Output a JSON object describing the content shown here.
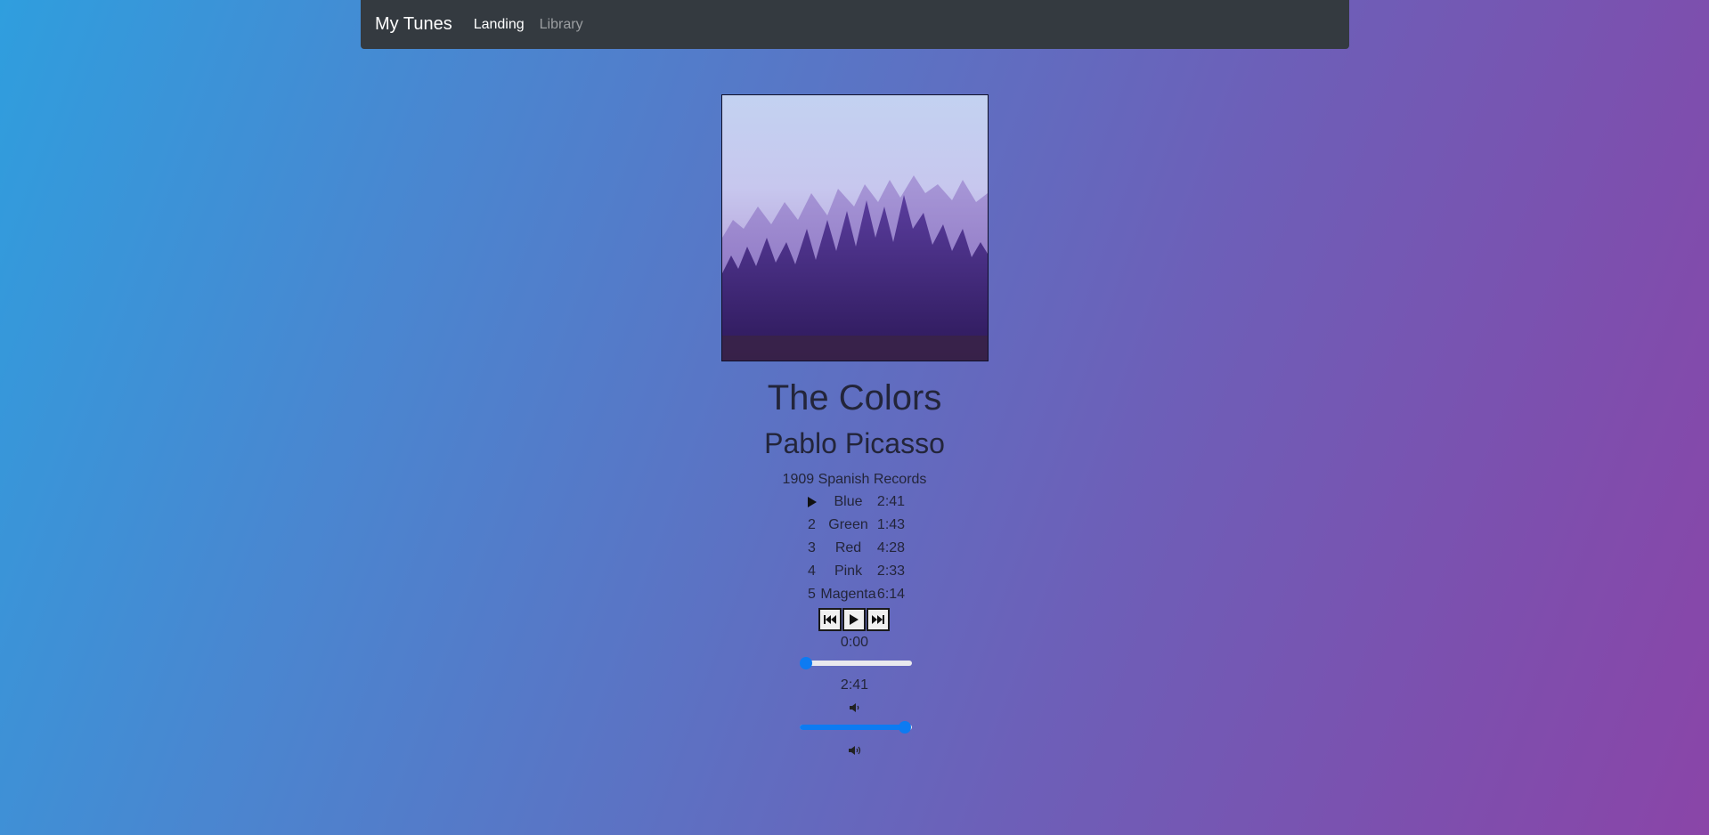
{
  "navbar": {
    "brand": "My Tunes",
    "links": [
      {
        "label": "Landing",
        "active": true
      },
      {
        "label": "Library",
        "active": false
      }
    ]
  },
  "album": {
    "title": "The Colors",
    "artist": "Pablo Picasso",
    "release": "1909 Spanish Records",
    "cover_icon": "misty-forest-image"
  },
  "songs": [
    {
      "number": "",
      "playing": true,
      "title": "Blue",
      "duration": "2:41"
    },
    {
      "number": "2",
      "playing": false,
      "title": "Green",
      "duration": "1:43"
    },
    {
      "number": "3",
      "playing": false,
      "title": "Red",
      "duration": "4:28"
    },
    {
      "number": "4",
      "playing": false,
      "title": "Pink",
      "duration": "2:33"
    },
    {
      "number": "5",
      "playing": false,
      "title": "Magenta",
      "duration": "6:14"
    }
  ],
  "player": {
    "controls": [
      "previous-icon",
      "play-icon",
      "next-icon"
    ],
    "current_time": "0:00",
    "total_time": "2:41",
    "seek_fraction": 0.0,
    "volume_fraction": 0.94
  },
  "colors": {
    "navbar": "#343a40",
    "accent": "#0d7bf2",
    "text": "#23253a"
  }
}
